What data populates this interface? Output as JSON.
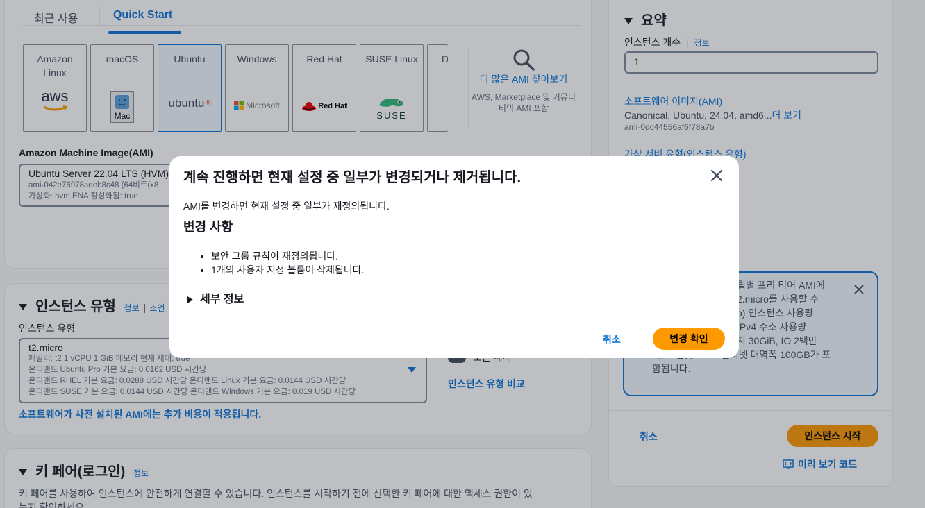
{
  "ami": {
    "tabs": [
      "최근 사용",
      "Quick Start"
    ],
    "os_cards": [
      "Amazon Linux",
      "macOS",
      "Ubuntu",
      "Windows",
      "Red Hat",
      "SUSE Linux",
      "D"
    ],
    "logos": {
      "aws": "aws",
      "mac": "Mac",
      "ubuntu": "ubuntu",
      "microsoft": "Microsoft",
      "redhat": "Red Hat",
      "suse": "SUSE"
    },
    "more_ami": "더 많은 AMI 찾아보기",
    "more_ami_desc": "AWS, Marketplace 및 커뮤니티의 AMI 포함",
    "heading": "Amazon Machine Image(AMI)",
    "selected_name": "Ubuntu Server 22.04 LTS (HVM),",
    "selected_id": "ami-042e76978adeb8c48 (64비트(x8",
    "selected_meta": "가상화: hvm    ENA 활성화됨: true"
  },
  "instance_type": {
    "title": "인스턴스 유형",
    "info": "정보",
    "sep": "|",
    "extra_link": "조언",
    "label": "인스턴스 유형",
    "value": "t2.micro",
    "family_line": "패밀리: t2    1 vCPU    1 GiB 메모리    현재 세대: true",
    "price_line1": "온디맨드 Ubuntu Pro 기본 요금: 0.0162 USD 시간당",
    "price_line2": "온디맨드 RHEL 기본 요금: 0.0288 USD 시간당    온디맨드 Linux 기본 요금: 0.0144 USD 시간당",
    "price_line3": "온디맨드 SUSE 기본 요금: 0.0144 USD 시간당    온디맨드 Windows 기본 요금: 0.019 USD 시간당",
    "software_note": "소프트웨어가 사전 설치된 AMI에는 추가 비용이 적용됩니다.",
    "toggle_label": "모든 세대",
    "compare_link": "인스턴스 유형 비교"
  },
  "key_pair": {
    "title": "키 페어(로그인)",
    "info": "정보",
    "desc_line1": "키 페어를 사용하여 인스턴스에 안전하게 연결할 수 있습니다. 인스턴스를 시작하기 전에 선택한 키 페어에 대한 액세스 권한이 있",
    "desc_line2": "는지 확인하세요."
  },
  "summary": {
    "title": "요약",
    "count_label": "인스턴스 개수",
    "info": "정보",
    "count_value": "1",
    "ami_label": "소프트웨어 이미지(AMI)",
    "ami_value": "Canonical, Ubuntu, 24.04, amd6...",
    "ami_more": "더 보기",
    "ami_id": "ami-0dc44556af6f78a7b",
    "server_label": "가상 서버 유형(인스턴스 유형)",
    "free_tier_lines": [
      "월별 프리 티어 AMI에",
      "2.micro를 사용할 수",
      "o) 인스턴스 사용량",
      "IPv4 주소 사용량",
      "지 30GiB, IO 2백만",
      "개, 스냅샷 1GB, 인터넷 대역폭 100GB가 포",
      "함됩니다."
    ],
    "cancel": "취소",
    "launch": "인스턴스 시작",
    "preview": "미리 보기 코드"
  },
  "modal": {
    "title": "계속 진행하면 현재 설정 중 일부가 변경되거나 제거됩니다.",
    "text": "AMI를 변경하면 현재 설정 중 일부가 재정의됩니다.",
    "subtitle": "변경 사항",
    "changes": [
      "보안 그룹 규칙이 재정의됩니다.",
      "1개의 사용자 지정 볼륨이 삭제됩니다."
    ],
    "details": "세부 정보",
    "cancel": "취소",
    "confirm": "변경 확인"
  },
  "colors": {
    "accent": "#0972d3",
    "primary_button": "#ff9900"
  }
}
